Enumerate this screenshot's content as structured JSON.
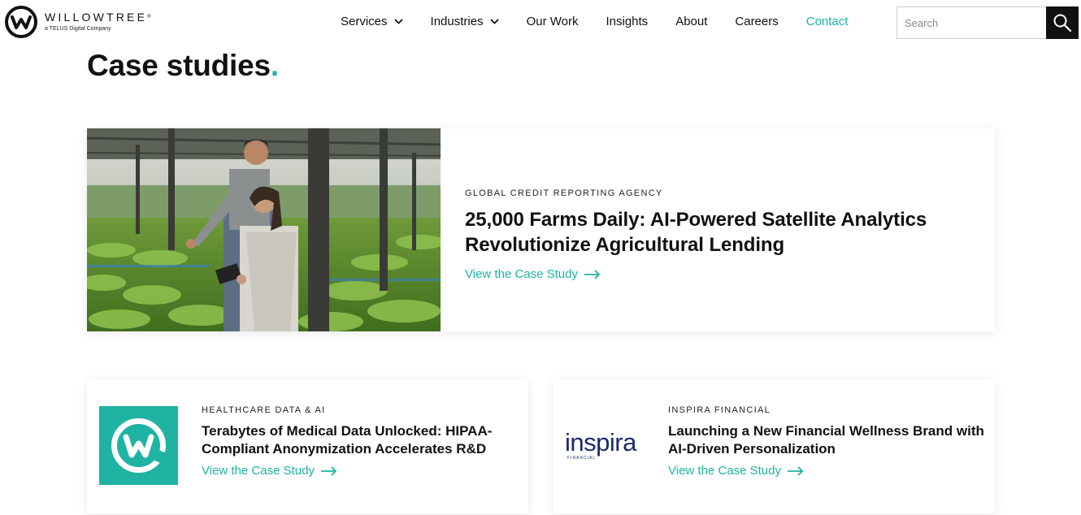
{
  "header": {
    "logo": {
      "name": "WILLOWTREE",
      "registered": "®",
      "tagline": "a TELUS Digital Company"
    },
    "nav": [
      {
        "label": "Services",
        "has_dropdown": true
      },
      {
        "label": "Industries",
        "has_dropdown": true
      },
      {
        "label": "Our Work",
        "has_dropdown": false
      },
      {
        "label": "Insights",
        "has_dropdown": false
      },
      {
        "label": "About",
        "has_dropdown": false
      },
      {
        "label": "Careers",
        "has_dropdown": false
      },
      {
        "label": "Contact",
        "has_dropdown": false
      }
    ],
    "search": {
      "placeholder": "Search",
      "value": "",
      "icon": "search-icon"
    }
  },
  "page": {
    "title": "Case studies",
    "title_dot": "."
  },
  "colors": {
    "accent": "#1fb3a4",
    "text": "#111111",
    "inspira_navy": "#1b2a6b"
  },
  "featured": {
    "eyebrow": "GLOBAL CREDIT REPORTING AGENCY",
    "title": "25,000 Farms Daily: AI-Powered Satellite Analytics Revolutionize Agricultural Lending",
    "cta": "View the Case Study"
  },
  "cards": [
    {
      "eyebrow": "HEALTHCARE DATA & AI",
      "title": "Terabytes of Medical Data Unlocked: HIPAA-Compliant Anonymization Accelerates R&D",
      "cta": "View the Case Study"
    },
    {
      "eyebrow": "INSPIRA FINANCIAL",
      "title": "Launching a New Financial Wellness Brand with AI-Driven Personalization",
      "cta": "View the Case Study",
      "logo_word": "inspira",
      "logo_sub": "FINANCIAL"
    }
  ]
}
